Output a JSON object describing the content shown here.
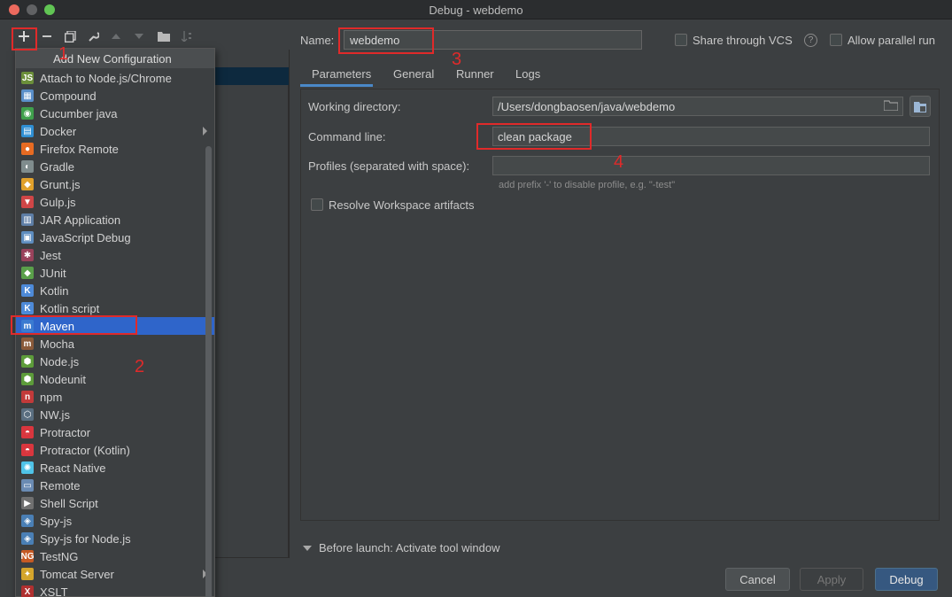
{
  "window": {
    "title": "Debug - webdemo"
  },
  "popup": {
    "header": "Add New Configuration",
    "items": [
      {
        "label": "Attach to Node.js/Chrome",
        "icon": "nodejs-attach-icon",
        "color": "#6b8f3a",
        "glyph": "JS"
      },
      {
        "label": "Compound",
        "icon": "compound-icon",
        "color": "#5a8fc9",
        "glyph": "▦"
      },
      {
        "label": "Cucumber java",
        "icon": "cucumber-icon",
        "color": "#3fa04c",
        "glyph": "◉"
      },
      {
        "label": "Docker",
        "icon": "docker-icon",
        "color": "#2f8fd3",
        "glyph": "▤",
        "submenu": true
      },
      {
        "label": "Firefox Remote",
        "icon": "firefox-icon",
        "color": "#e76b22",
        "glyph": "●"
      },
      {
        "label": "Gradle",
        "icon": "gradle-icon",
        "color": "#7f8c8d",
        "glyph": "◐"
      },
      {
        "label": "Grunt.js",
        "icon": "grunt-icon",
        "color": "#e1a12b",
        "glyph": "◆"
      },
      {
        "label": "Gulp.js",
        "icon": "gulp-icon",
        "color": "#cf4647",
        "glyph": "▼"
      },
      {
        "label": "JAR Application",
        "icon": "jar-icon",
        "color": "#5e7ea6",
        "glyph": "▥"
      },
      {
        "label": "JavaScript Debug",
        "icon": "js-debug-icon",
        "color": "#5e8dbf",
        "glyph": "▣"
      },
      {
        "label": "Jest",
        "icon": "jest-icon",
        "color": "#99425b",
        "glyph": "✱"
      },
      {
        "label": "JUnit",
        "icon": "junit-icon",
        "color": "#5aa04a",
        "glyph": "◆"
      },
      {
        "label": "Kotlin",
        "icon": "kotlin-icon",
        "color": "#4d8ad8",
        "glyph": "K"
      },
      {
        "label": "Kotlin script",
        "icon": "kotlin-script-icon",
        "color": "#4d8ad8",
        "glyph": "K"
      },
      {
        "label": "Maven",
        "icon": "maven-icon",
        "color": "#3b7bd1",
        "glyph": "m",
        "selected": true
      },
      {
        "label": "Mocha",
        "icon": "mocha-icon",
        "color": "#8a5a3a",
        "glyph": "m"
      },
      {
        "label": "Node.js",
        "icon": "nodejs-icon",
        "color": "#5d9c3a",
        "glyph": "⬢"
      },
      {
        "label": "Nodeunit",
        "icon": "nodeunit-icon",
        "color": "#5d9c3a",
        "glyph": "⬢"
      },
      {
        "label": "npm",
        "icon": "npm-icon",
        "color": "#c23a3a",
        "glyph": "n"
      },
      {
        "label": "NW.js",
        "icon": "nwjs-icon",
        "color": "#5a6e80",
        "glyph": "⬡"
      },
      {
        "label": "Protractor",
        "icon": "protractor-icon",
        "color": "#d9363e",
        "glyph": "◓"
      },
      {
        "label": "Protractor (Kotlin)",
        "icon": "protractor-kotlin-icon",
        "color": "#d9363e",
        "glyph": "◓"
      },
      {
        "label": "React Native",
        "icon": "react-icon",
        "color": "#4fc3e8",
        "glyph": "✺"
      },
      {
        "label": "Remote",
        "icon": "remote-icon",
        "color": "#6a8bb3",
        "glyph": "▭"
      },
      {
        "label": "Shell Script",
        "icon": "shell-icon",
        "color": "#707070",
        "glyph": "▶"
      },
      {
        "label": "Spy-js",
        "icon": "spyjs-icon",
        "color": "#4a7fb5",
        "glyph": "◈"
      },
      {
        "label": "Spy-js for Node.js",
        "icon": "spyjs-node-icon",
        "color": "#4a7fb5",
        "glyph": "◈"
      },
      {
        "label": "TestNG",
        "icon": "testng-icon",
        "color": "#c55a24",
        "glyph": "NG"
      },
      {
        "label": "Tomcat Server",
        "icon": "tomcat-icon",
        "color": "#d4a52c",
        "glyph": "✦",
        "submenu": true
      },
      {
        "label": "XSLT",
        "icon": "xslt-icon",
        "color": "#b03030",
        "glyph": "X"
      }
    ]
  },
  "config": {
    "name_label": "Name:",
    "name_value": "webdemo",
    "share_vcs": "Share through VCS",
    "allow_parallel": "Allow parallel run",
    "help_glyph": "?",
    "tabs": [
      "Parameters",
      "General",
      "Runner",
      "Logs"
    ],
    "working_dir_label": "Working directory:",
    "working_dir_value": "/Users/dongbaosen/java/webdemo",
    "command_line_label": "Command line:",
    "command_line_value": "clean package",
    "profiles_label": "Profiles (separated with space):",
    "profiles_value": "",
    "profiles_hint": "add prefix '-' to disable profile, e.g. \"-test\"",
    "resolve_workspace": "Resolve Workspace artifacts",
    "before_launch": "Before launch: Activate tool window"
  },
  "buttons": {
    "cancel": "Cancel",
    "apply": "Apply",
    "debug": "Debug"
  },
  "annotations": [
    "1",
    "2",
    "3",
    "4"
  ],
  "colors": {
    "accent": "#2f65ca",
    "annotation": "#e02a2a",
    "debug_button": "#365880"
  }
}
